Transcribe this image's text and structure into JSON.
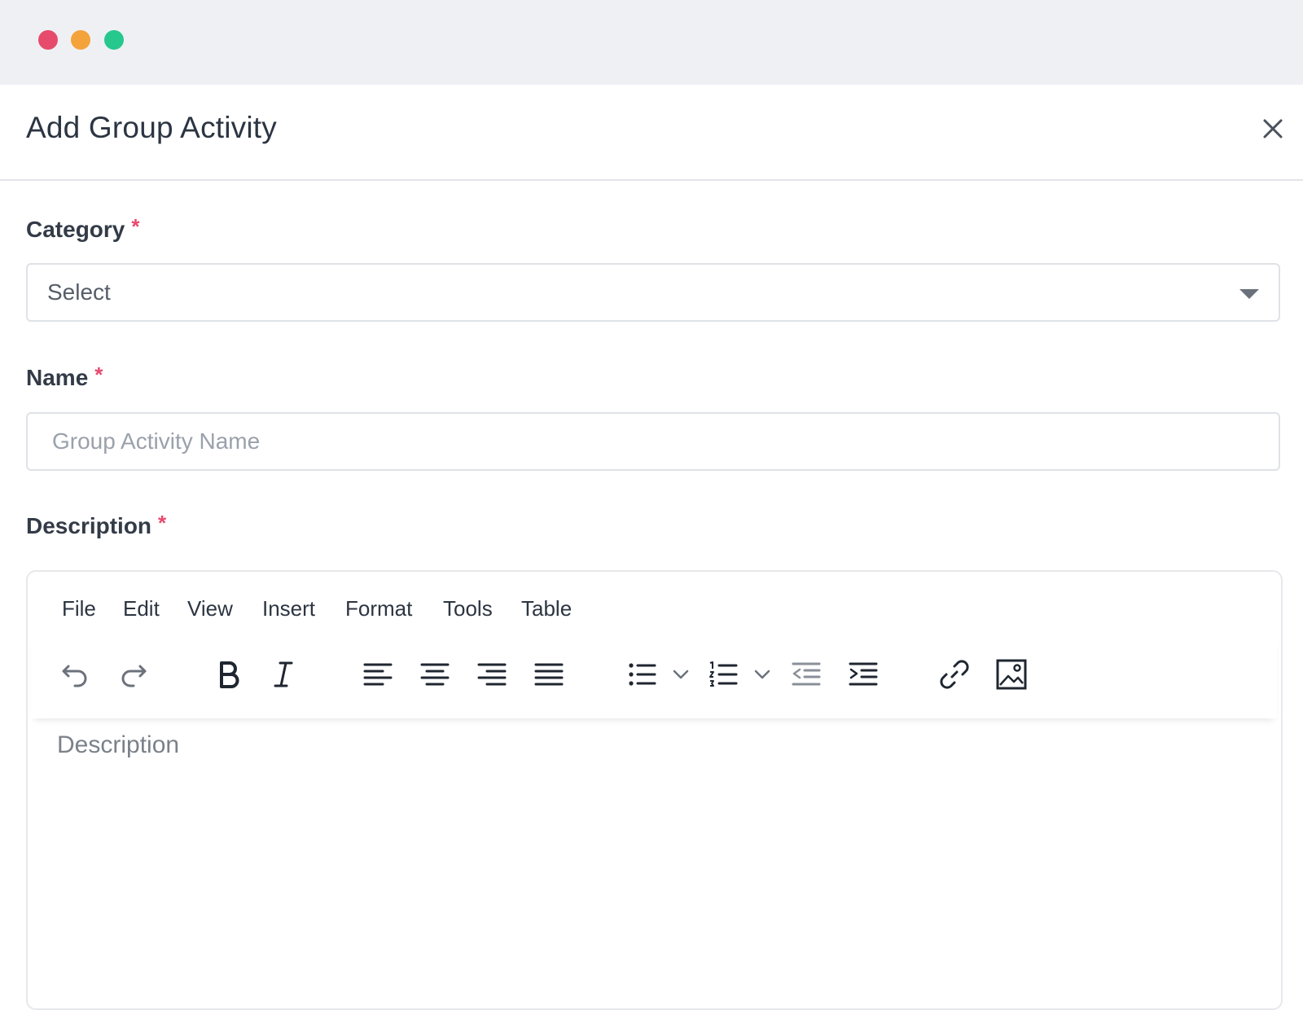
{
  "window": {
    "traffic_lights": {
      "red": "#e64b6b",
      "yellow": "#f4a33a",
      "green": "#26c88e"
    }
  },
  "modal": {
    "title": "Add Group Activity",
    "close_icon": "close-icon"
  },
  "fields": {
    "category": {
      "label": "Category",
      "required_mark": "*",
      "value": "Select"
    },
    "name": {
      "label": "Name",
      "required_mark": "*",
      "placeholder": "Group Activity Name"
    },
    "description": {
      "label": "Description",
      "required_mark": "*"
    }
  },
  "editor": {
    "menu": [
      "File",
      "Edit",
      "View",
      "Insert",
      "Format",
      "Tools",
      "Table"
    ],
    "toolbar_icons": [
      "undo-icon",
      "redo-icon",
      "bold-icon",
      "italic-icon",
      "align-left-icon",
      "align-center-icon",
      "align-right-icon",
      "align-justify-icon",
      "bullet-list-icon",
      "numbered-list-icon",
      "outdent-icon",
      "indent-icon",
      "link-icon",
      "image-icon"
    ],
    "placeholder": "Description"
  },
  "colors": {
    "required": "#e8496e",
    "text": "#2c3542",
    "border": "#dfe2e6"
  }
}
